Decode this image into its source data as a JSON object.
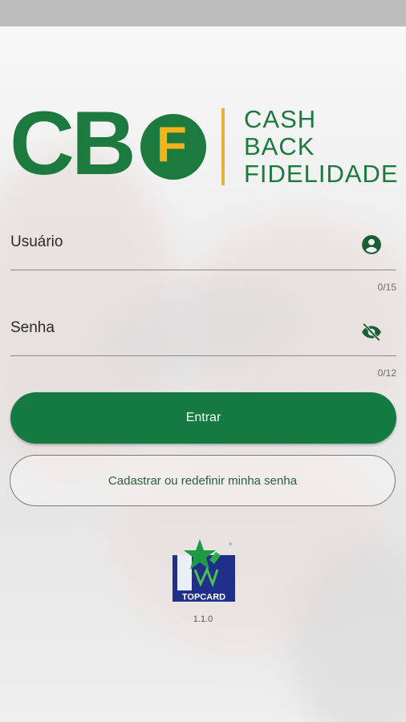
{
  "logo": {
    "letters": "CB",
    "circle_letter": "F",
    "words": [
      "CASH",
      "BACK",
      "FIDELIDADE"
    ],
    "primary_color": "#1c7a3e",
    "accent_color": "#f2b31c"
  },
  "username": {
    "label": "Usuário",
    "counter": "0/15",
    "icon": "account-circle-icon"
  },
  "password": {
    "label": "Senha",
    "counter": "0/12",
    "icon": "eye-off-icon"
  },
  "buttons": {
    "login": "Entrar",
    "register": "Cadastrar ou redefinir minha senha"
  },
  "brand": {
    "name": "TOPCARD"
  },
  "version": "1.1.0"
}
